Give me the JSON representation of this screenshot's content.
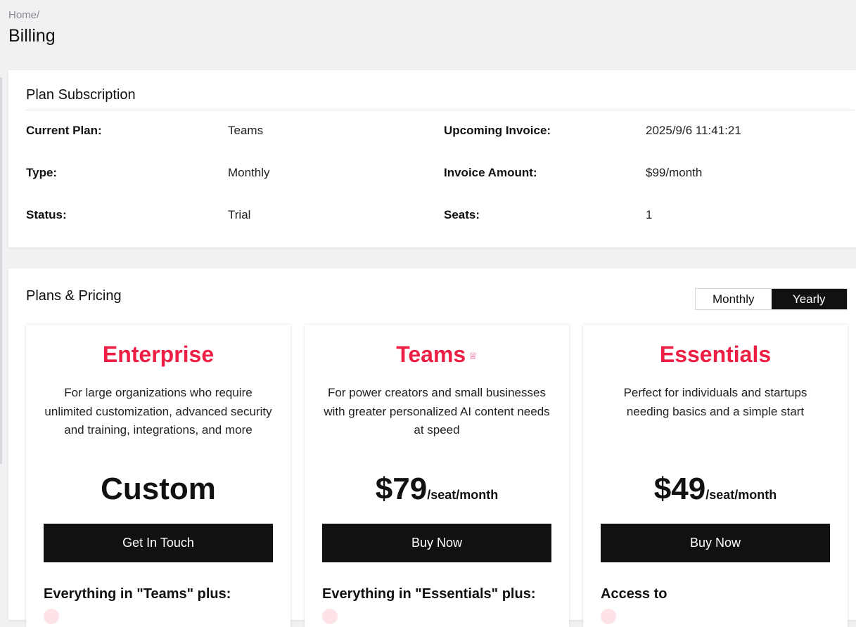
{
  "breadcrumb": "Home/",
  "page_title": "Billing",
  "subscription": {
    "title": "Plan Subscription",
    "current_plan_label": "Current Plan:",
    "current_plan_value": "Teams",
    "type_label": "Type:",
    "type_value": "Monthly",
    "status_label": "Status:",
    "status_value": "Trial",
    "upcoming_invoice_label": "Upcoming Invoice:",
    "upcoming_invoice_value": "2025/9/6 11:41:21",
    "invoice_amount_label": "Invoice Amount:",
    "invoice_amount_value": "$99/month",
    "seats_label": "Seats:",
    "seats_value": "1"
  },
  "pricing": {
    "title": "Plans & Pricing",
    "toggle": {
      "monthly": "Monthly",
      "yearly": "Yearly",
      "selected": "Yearly"
    },
    "plans": [
      {
        "name": "Enterprise",
        "description": "For large organizations who require unlimited customization, advanced security and training, integrations, and more",
        "price": "Custom",
        "unit": "",
        "button": "Get In Touch",
        "features_heading": "Everything in \"Teams\" plus:"
      },
      {
        "name": "Teams",
        "icon": "crown-icon",
        "description": "For power creators and small businesses with greater personalized AI content needs at speed",
        "price": "$79",
        "unit": "/seat/month",
        "button": "Buy Now",
        "features_heading": "Everything in \"Essentials\" plus:"
      },
      {
        "name": "Essentials",
        "description": "Perfect for individuals and startups needing basics and a simple start",
        "price": "$49",
        "unit": "/seat/month",
        "button": "Buy Now",
        "features_heading": "Access to"
      }
    ]
  },
  "colors": {
    "accent": "#ee1f44",
    "button": "#111111",
    "background": "#f1f1f3"
  }
}
